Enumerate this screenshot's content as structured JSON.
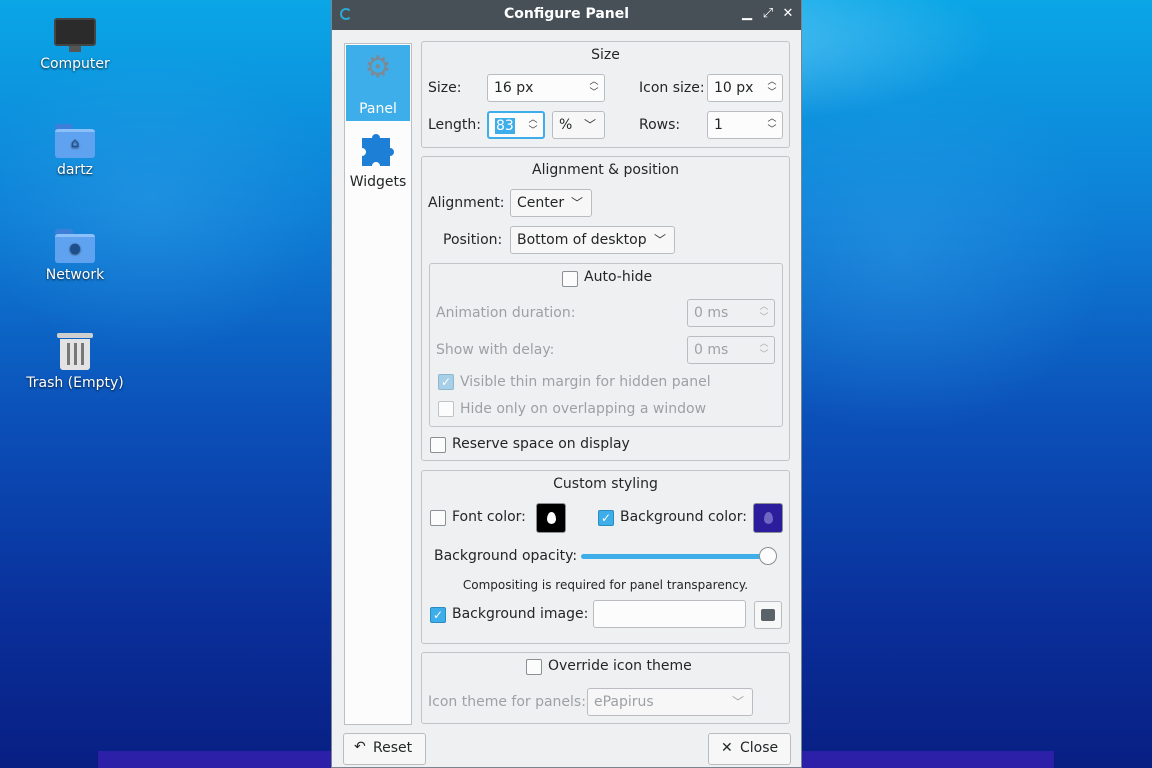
{
  "desktop": {
    "icons": [
      {
        "label": "Computer"
      },
      {
        "label": "dartz"
      },
      {
        "label": "Network"
      },
      {
        "label": "Trash (Empty)"
      }
    ]
  },
  "dialog": {
    "title": "Configure Panel",
    "sidebar": {
      "panel_label": "Panel",
      "widgets_label": "Widgets"
    },
    "size": {
      "title": "Size",
      "size_label": "Size:",
      "size_value": "16 px",
      "icon_size_label": "Icon size:",
      "icon_size_value": "10 px",
      "length_label": "Length:",
      "length_value": "83",
      "length_unit": "%",
      "rows_label": "Rows:",
      "rows_value": "1"
    },
    "alignment": {
      "title": "Alignment & position",
      "alignment_label": "Alignment:",
      "alignment_value": "Center",
      "position_label": "Position:",
      "position_value": "Bottom of desktop",
      "autohide_label": "Auto-hide",
      "autohide_checked": false,
      "animation_label": "Animation duration:",
      "animation_value": "0 ms",
      "delay_label": "Show with delay:",
      "delay_value": "0 ms",
      "thin_margin_label": "Visible thin margin for hidden panel",
      "thin_margin_checked": true,
      "overlap_label": "Hide only on overlapping a window",
      "overlap_checked": false,
      "reserve_label": "Reserve space on display",
      "reserve_checked": false
    },
    "styling": {
      "title": "Custom styling",
      "font_color_label": "Font color:",
      "font_color_checked": false,
      "font_color": "#000000",
      "bg_color_label": "Background color:",
      "bg_color_checked": true,
      "bg_color": "#2b1d9c",
      "opacity_label": "Background opacity:",
      "opacity_value": 1.0,
      "compositing_note": "Compositing is required for panel transparency.",
      "bg_image_label": "Background image:",
      "bg_image_checked": true,
      "bg_image_value": ""
    },
    "icon_theme": {
      "override_label": "Override icon theme",
      "override_checked": false,
      "theme_label": "Icon theme for panels:",
      "theme_value": "ePapirus"
    },
    "buttons": {
      "reset_label": "Reset",
      "close_label": "Close"
    }
  },
  "colors": {
    "accent": "#3daee9",
    "titlebar": "#475057"
  }
}
